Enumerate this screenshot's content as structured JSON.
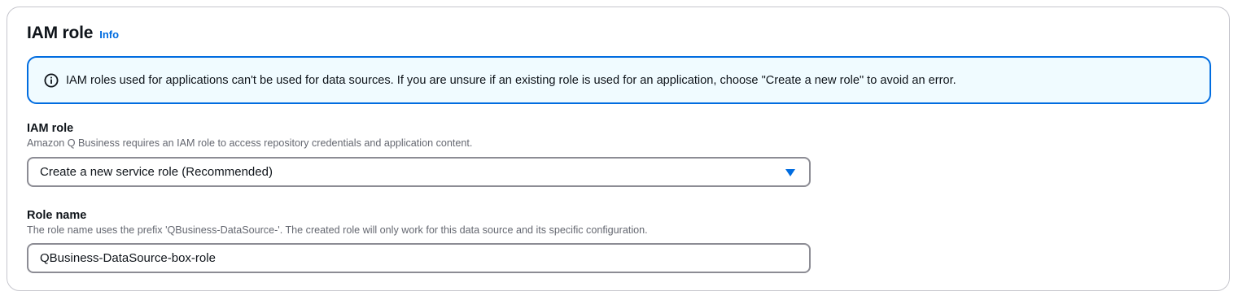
{
  "section": {
    "title": "IAM role",
    "info_label": "Info"
  },
  "alert": {
    "icon": "info-circle-icon",
    "text": "IAM roles used for applications can't be used for data sources. If you are unsure if an existing role is used for an application, choose \"Create a new role\" to avoid an error.",
    "accent_color": "#006ce0",
    "background_color": "#f0fbff"
  },
  "iam_role_field": {
    "label": "IAM role",
    "description": "Amazon Q Business requires an IAM role to access repository credentials and application content.",
    "selected_value": "Create a new service role (Recommended)"
  },
  "role_name_field": {
    "label": "Role name",
    "description": "The role name uses the prefix 'QBusiness-DataSource-'. The created role will only work for this data source and its specific configuration.",
    "value": "QBusiness-DataSource-box-role"
  }
}
